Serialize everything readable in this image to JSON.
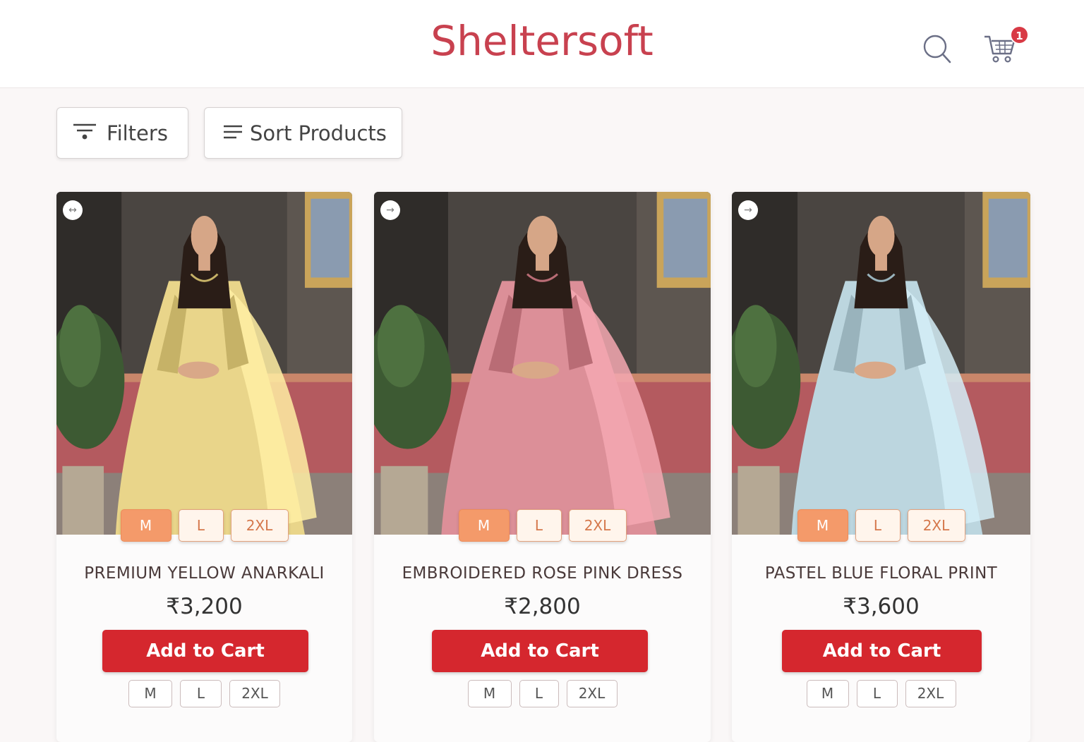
{
  "brand": "Sheltersoft",
  "colors": {
    "brand": "#c8414f",
    "accent": "#d5272e",
    "size_selected": "#f49a6a"
  },
  "header": {
    "search_icon": "search-icon",
    "cart_icon": "cart-icon",
    "cart_count": "1"
  },
  "toolbar": {
    "filters_label": "Filters",
    "filters_icon": "filter-icon",
    "sort_label": "Sort Products",
    "sort_icon": "sort-lines-icon"
  },
  "products": [
    {
      "title": "PREMIUM YELLOW ANARKALI",
      "price": "₹3,200",
      "cta": "Add to Cart",
      "sizes": [
        "M",
        "L",
        "2XL"
      ],
      "selected_size": "M",
      "arrow": "↔",
      "dress_color": "#e9d58a"
    },
    {
      "title": "EMBROIDERED ROSE PINK DRESS",
      "price": "₹2,800",
      "cta": "Add to Cart",
      "sizes": [
        "M",
        "L",
        "2XL"
      ],
      "selected_size": "M",
      "arrow": "→",
      "dress_color": "#dc8f98"
    },
    {
      "title": "PASTEL BLUE FLORAL PRINT",
      "price": "₹3,600",
      "cta": "Add to Cart",
      "sizes": [
        "M",
        "L",
        "2XL"
      ],
      "selected_size": "M",
      "arrow": "→",
      "dress_color": "#bcd6df"
    }
  ]
}
